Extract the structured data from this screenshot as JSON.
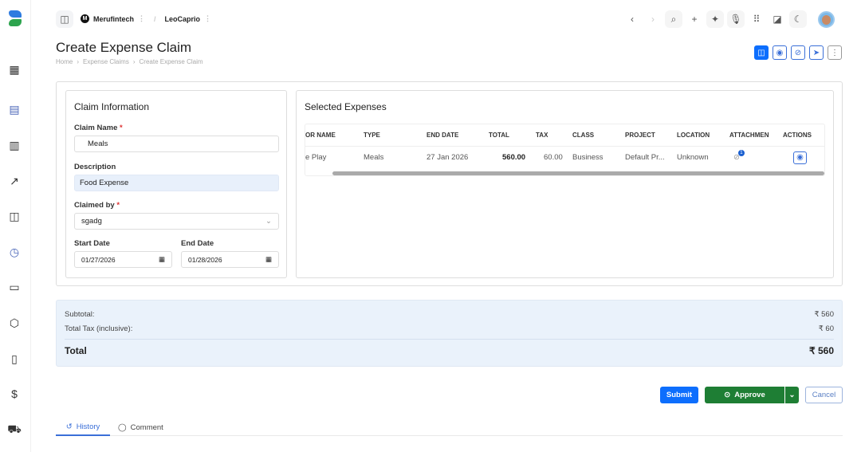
{
  "header": {
    "org": "Merufintech",
    "org_initial": "M",
    "user": "LeoCaprio",
    "separator": "/"
  },
  "page": {
    "title": "Create Expense Claim",
    "breadcrumb": [
      "Home",
      "Expense Claims",
      "Create Expense Claim"
    ]
  },
  "claim_info": {
    "title": "Claim Information",
    "claim_name_label": "Claim Name",
    "claim_name": "Meals",
    "description_label": "Description",
    "description": "Food Expense",
    "claimed_by_label": "Claimed by",
    "claimed_by": "sgadg",
    "start_date_label": "Start Date",
    "start_date": "01/27/2026",
    "end_date_label": "End Date",
    "end_date": "01/28/2026",
    "required": "*"
  },
  "expenses": {
    "title": "Selected Expenses",
    "columns": [
      "OR NAME",
      "TYPE",
      "END DATE",
      "TOTAL",
      "TAX",
      "CLASS",
      "PROJECT",
      "LOCATION",
      "ATTACHMEN",
      "ACTIONS"
    ],
    "rows": [
      {
        "name": "e Play",
        "type": "Meals",
        "end_date": "27 Jan 2026",
        "total": "560.00",
        "tax": "60.00",
        "class": "Business",
        "project": "Default Pr...",
        "location": "Unknown",
        "attachments": "1"
      }
    ]
  },
  "summary": {
    "subtotal_label": "Subtotal:",
    "subtotal": "₹ 560",
    "tax_label": "Total Tax (inclusive):",
    "tax": "₹ 60",
    "total_label": "Total",
    "total": "₹ 560"
  },
  "actions": {
    "submit": "Submit",
    "approve": "Approve",
    "cancel": "Cancel"
  },
  "tabs": {
    "history": "History",
    "comment": "Comment"
  },
  "colors": {
    "primary": "#0d6efd",
    "approve": "#1e7e34"
  }
}
